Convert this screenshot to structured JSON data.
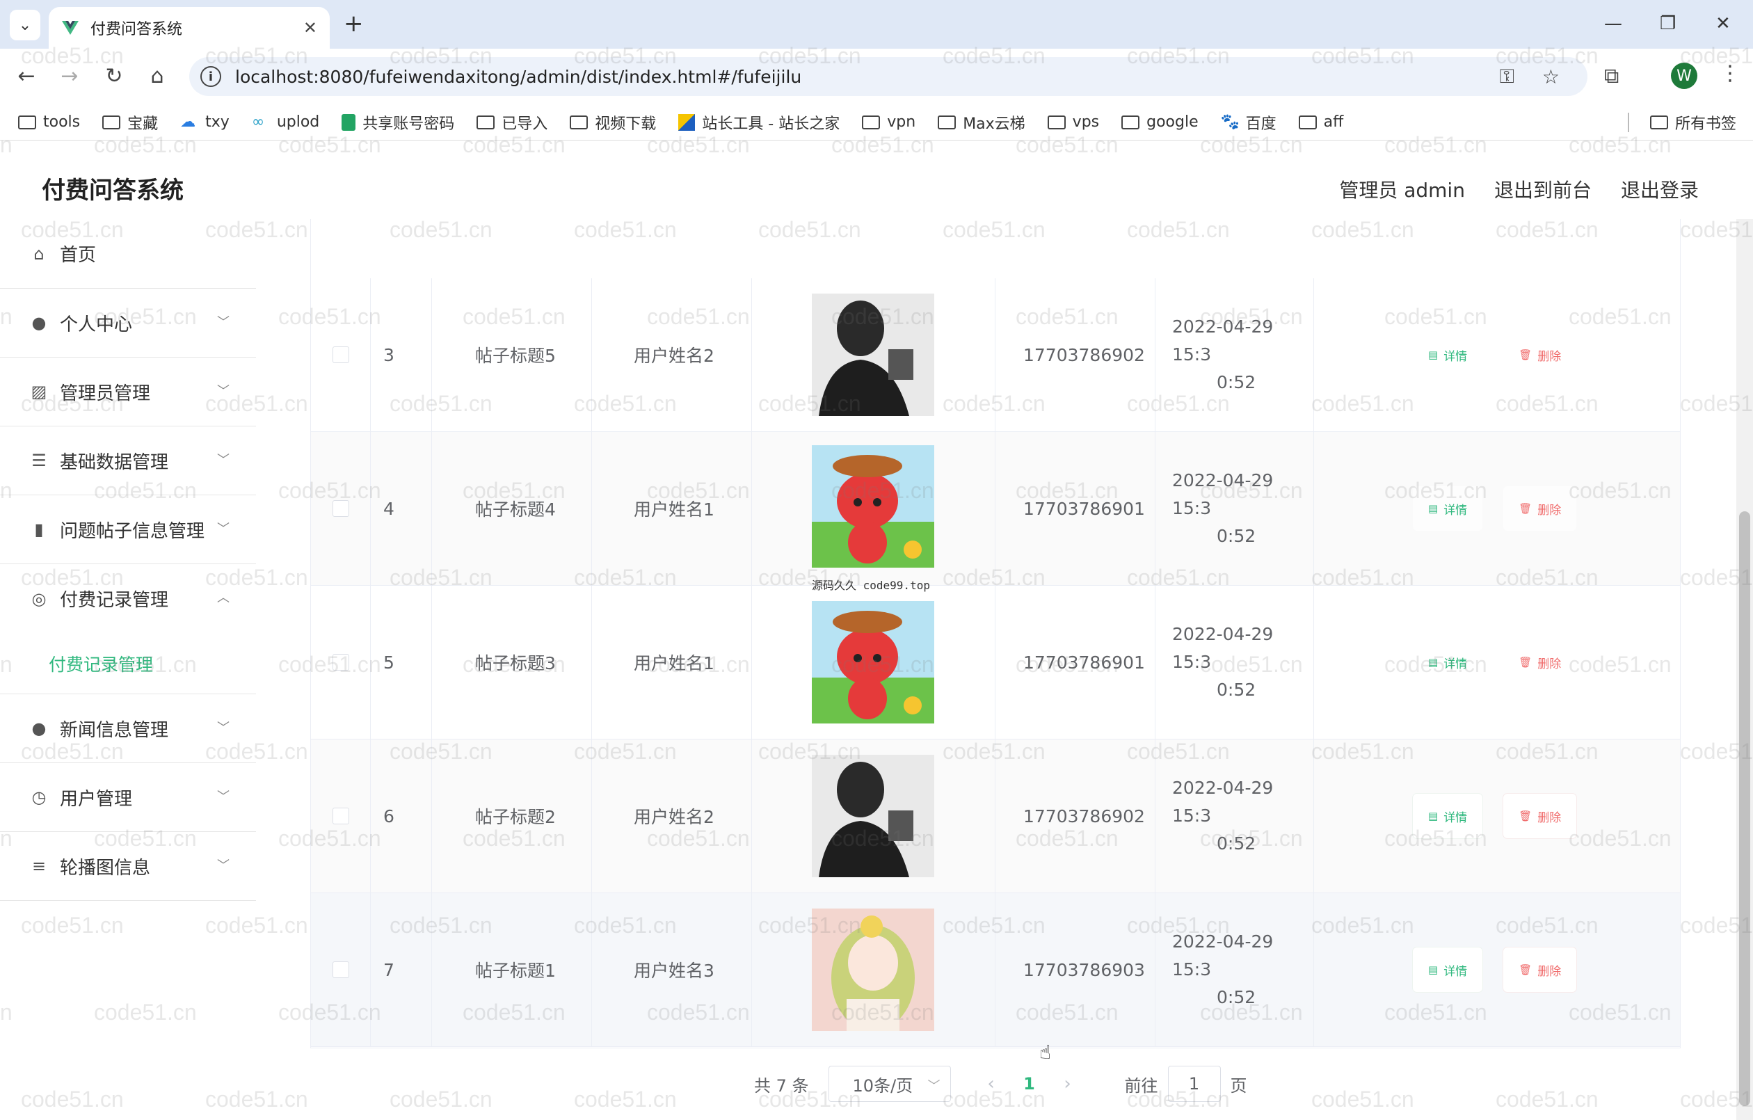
{
  "browser": {
    "tab_title": "付费问答系统",
    "url": "localhost:8080/fufeiwendaxitong/admin/dist/index.html#/fufeijilu",
    "profile_initial": "W",
    "bookmarks": [
      "tools",
      "宝藏",
      "txy",
      "uplod",
      "共享账号密码",
      "已导入",
      "视频下载",
      "站长工具 - 站长之家",
      "vpn",
      "Max云梯",
      "vps",
      "google",
      "百度",
      "aff"
    ],
    "all_bookmarks": "所有书签"
  },
  "header": {
    "title": "付费问答系统",
    "admin_label": "管理员 admin",
    "to_front": "退出到前台",
    "logout": "退出登录"
  },
  "sidebar": {
    "items": [
      {
        "label": "首页",
        "icon": "home-icon"
      },
      {
        "label": "个人中心",
        "icon": "person-icon"
      },
      {
        "label": "管理员管理",
        "icon": "chart-icon"
      },
      {
        "label": "基础数据管理",
        "icon": "sliders-icon"
      },
      {
        "label": "问题帖子信息管理",
        "icon": "bookmark-icon"
      },
      {
        "label": "付费记录管理",
        "icon": "compass-icon"
      },
      {
        "label": "新闻信息管理",
        "icon": "person-icon"
      },
      {
        "label": "用户管理",
        "icon": "gauge-icon"
      },
      {
        "label": "轮播图信息",
        "icon": "list-icon"
      }
    ],
    "active_sub": "付费记录管理"
  },
  "table": {
    "rows": [
      {
        "idx": "3",
        "title": "帖子标题5",
        "user": "用户姓名2",
        "image": "man",
        "phone": "17703786902",
        "time": "2022-04-29 15:30:52"
      },
      {
        "idx": "4",
        "title": "帖子标题4",
        "user": "用户姓名1",
        "image": "fox",
        "phone": "17703786901",
        "time": "2022-04-29 15:30:52",
        "caption": "源码久久 code99.top"
      },
      {
        "idx": "5",
        "title": "帖子标题3",
        "user": "用户姓名1",
        "image": "fox",
        "phone": "17703786901",
        "time": "2022-04-29 15:30:52"
      },
      {
        "idx": "6",
        "title": "帖子标题2",
        "user": "用户姓名2",
        "image": "man",
        "phone": "17703786902",
        "time": "2022-04-29 15:30:52"
      },
      {
        "idx": "7",
        "title": "帖子标题1",
        "user": "用户姓名3",
        "image": "girl",
        "phone": "17703786903",
        "time": "2022-04-29 15:30:52"
      }
    ],
    "time_line1": "2022-04-29 15:3",
    "time_line2": "0:52",
    "detail_label": "详情",
    "delete_label": "删除"
  },
  "pager": {
    "total": "共 7 条",
    "page_size": "10条/页",
    "current": "1",
    "goto_label": "前往",
    "goto_value": "1",
    "page_suffix": "页"
  },
  "watermark": "code51.cn",
  "colors": {
    "accent": "#2fb87e",
    "danger": "#f06b6b"
  }
}
